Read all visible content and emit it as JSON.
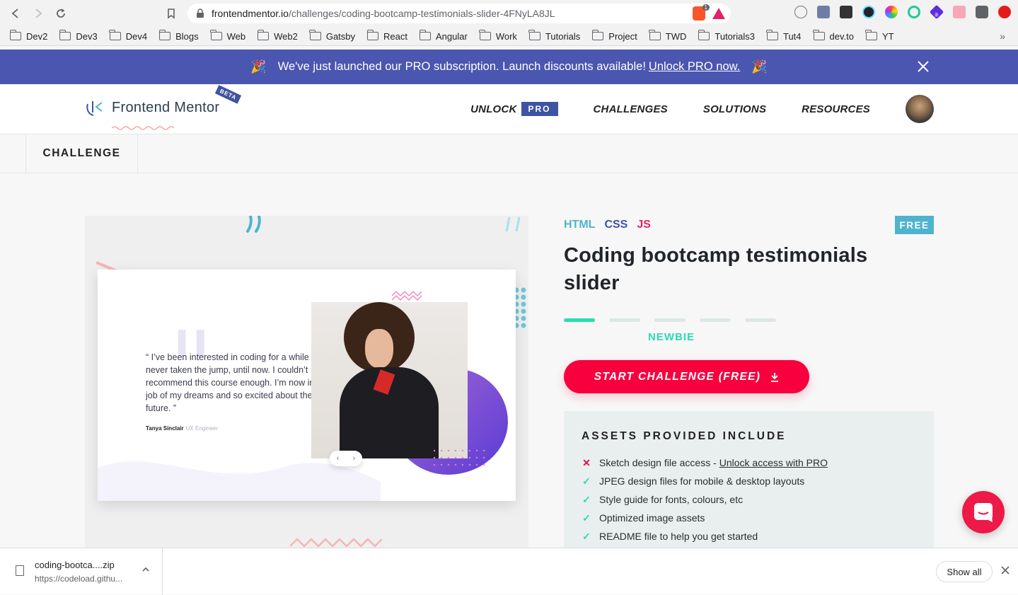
{
  "browser": {
    "url_host": "frontendmentor.io",
    "url_path": "/challenges/coding-bootcamp-testimonials-slider-4FNyLA8JL",
    "brave_count": "1",
    "bookmarks": [
      "Dev2",
      "Dev3",
      "Dev4",
      "Blogs",
      "Web",
      "Web2",
      "Gatsby",
      "React",
      "Angular",
      "Work",
      "Tutorials",
      "Project",
      "TWD",
      "Tutorials3",
      "Tut4",
      "dev.to",
      "YT"
    ],
    "bookmarks_more": "»",
    "extension_badge": "8"
  },
  "banner": {
    "text": "We've just launched our PRO subscription. Launch discounts available!",
    "link": "Unlock PRO now.",
    "emoji": "🎉"
  },
  "header": {
    "logo_text": "Frontend Mentor",
    "beta": "BETA",
    "nav": {
      "unlock": "UNLOCK",
      "pro": "PRO",
      "challenges": "CHALLENGES",
      "solutions": "SOLUTIONS",
      "resources": "RESOURCES"
    }
  },
  "tabbar": {
    "challenge": "CHALLENGE"
  },
  "preview": {
    "quote": "“ I’ve been interested in coding for a while but never taken the jump, until now. I couldn’t recommend this course enough. I’m now in the job of my dreams and so excited about the future. ”",
    "author": "Tanya Sinclair",
    "role": "UX Engineer",
    "prev": "‹",
    "next": "›"
  },
  "challenge": {
    "tags": {
      "html": "HTML",
      "css": "CSS",
      "js": "JS"
    },
    "price_badge": "FREE",
    "title": "Coding bootcamp testimonials slider",
    "difficulty_level": 1,
    "difficulty_total": 5,
    "difficulty_label": "NEWBIE",
    "start_button": "START CHALLENGE (FREE)",
    "assets_title": "ASSETS PROVIDED INCLUDE",
    "assets": [
      {
        "text": "Sketch design file access - ",
        "link": "Unlock access with PRO",
        "included": false
      },
      {
        "text": "JPEG design files for mobile & desktop layouts",
        "included": true
      },
      {
        "text": "Style guide for fonts, colours, etc",
        "included": true
      },
      {
        "text": "Optimized image assets",
        "included": true
      },
      {
        "text": "README file to help you get started",
        "included": true
      }
    ]
  },
  "download_shelf": {
    "file_name": "coding-bootca....zip",
    "source": "https://codeload.githu...",
    "show_all": "Show all"
  },
  "colors": {
    "banner": "#4a56b0",
    "accent_red": "#f8003d",
    "accent_teal": "#2bdbb0",
    "pro_blue": "#3e54a3",
    "html_tag": "#4fb3cd",
    "js_tag": "#e2226b"
  }
}
